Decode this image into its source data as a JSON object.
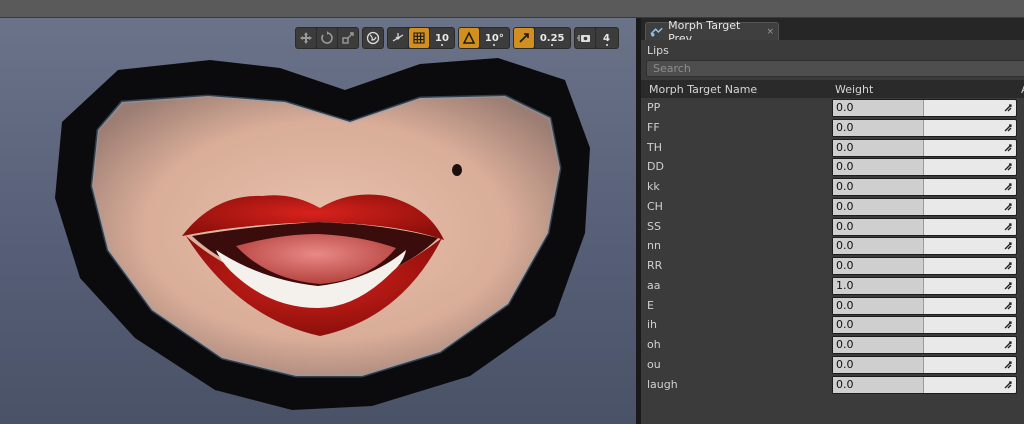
{
  "toolbar": {
    "grid_snap_value": "10",
    "rotation_snap_value": "10°",
    "scale_snap_value": "0.25",
    "camera_speed_value": "4"
  },
  "panel": {
    "tab_title": "Morph Target Prev",
    "tab_close": "×",
    "section_label": "Lips",
    "search_placeholder": "Search",
    "col_name": "Morph Target Name",
    "col_weight": "Weight",
    "col_extra": "A",
    "morph_targets": [
      {
        "name": "PP",
        "weight": "0.0"
      },
      {
        "name": "FF",
        "weight": "0.0"
      },
      {
        "name": "TH",
        "weight": "0.0"
      },
      {
        "name": "DD",
        "weight": "0.0"
      },
      {
        "name": "kk",
        "weight": "0.0"
      },
      {
        "name": "CH",
        "weight": "0.0"
      },
      {
        "name": "SS",
        "weight": "0.0"
      },
      {
        "name": "nn",
        "weight": "0.0"
      },
      {
        "name": "RR",
        "weight": "0.0"
      },
      {
        "name": "aa",
        "weight": "1.0"
      },
      {
        "name": "E",
        "weight": "0.0"
      },
      {
        "name": "ih",
        "weight": "0.0"
      },
      {
        "name": "oh",
        "weight": "0.0"
      },
      {
        "name": "ou",
        "weight": "0.0"
      },
      {
        "name": "laugh",
        "weight": "0.0"
      }
    ]
  },
  "colors": {
    "accent": "#d18f1f",
    "panel_bg": "#3b3b3b",
    "viewport_bg": "#5d667d"
  }
}
